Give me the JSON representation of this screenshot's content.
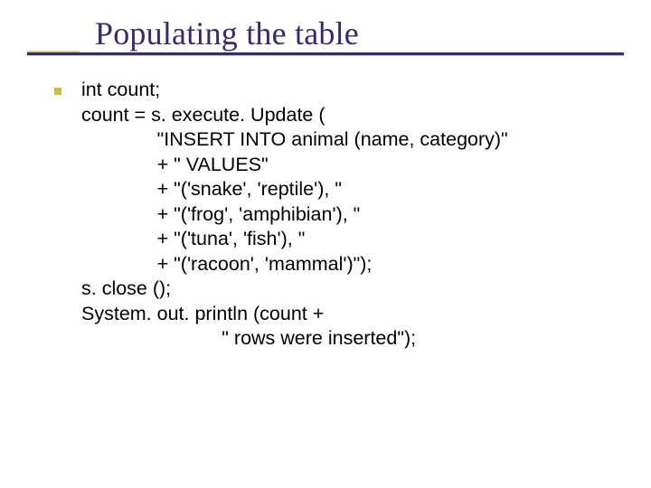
{
  "title": "Populating the table",
  "code": {
    "l1": "int count;",
    "l2": "count = s. execute. Update (",
    "l3": "              \"INSERT INTO animal (name, category)\"",
    "l4": "              + \" VALUES\"",
    "l5": "              + \"('snake', 'reptile'), \"",
    "l6": "              + \"('frog', 'amphibian'), \"",
    "l7": "              + \"('tuna', 'fish'), \"",
    "l8": "              + \"('racoon', 'mammal')\");",
    "l9": "s. close ();",
    "l10": "System. out. println (count +",
    "l11": "                          \" rows were inserted\");"
  }
}
